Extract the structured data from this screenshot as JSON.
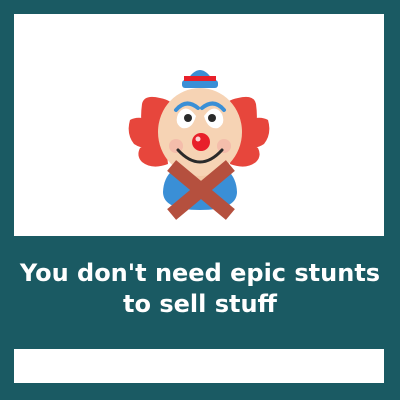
{
  "caption": {
    "line1": "You don't need epic stunts",
    "line2": "to sell stuff"
  },
  "illustration": {
    "icon": "clown-icon",
    "overlay_icon": "cross-x-icon"
  },
  "colors": {
    "background": "#1a5a63",
    "panel": "#ffffff",
    "caption_text": "#ffffff",
    "hair": "#e7463c",
    "hat": "#3a8fd6",
    "nose": "#e8202a",
    "cross": "#b5503e",
    "body": "#3a8fd6"
  }
}
